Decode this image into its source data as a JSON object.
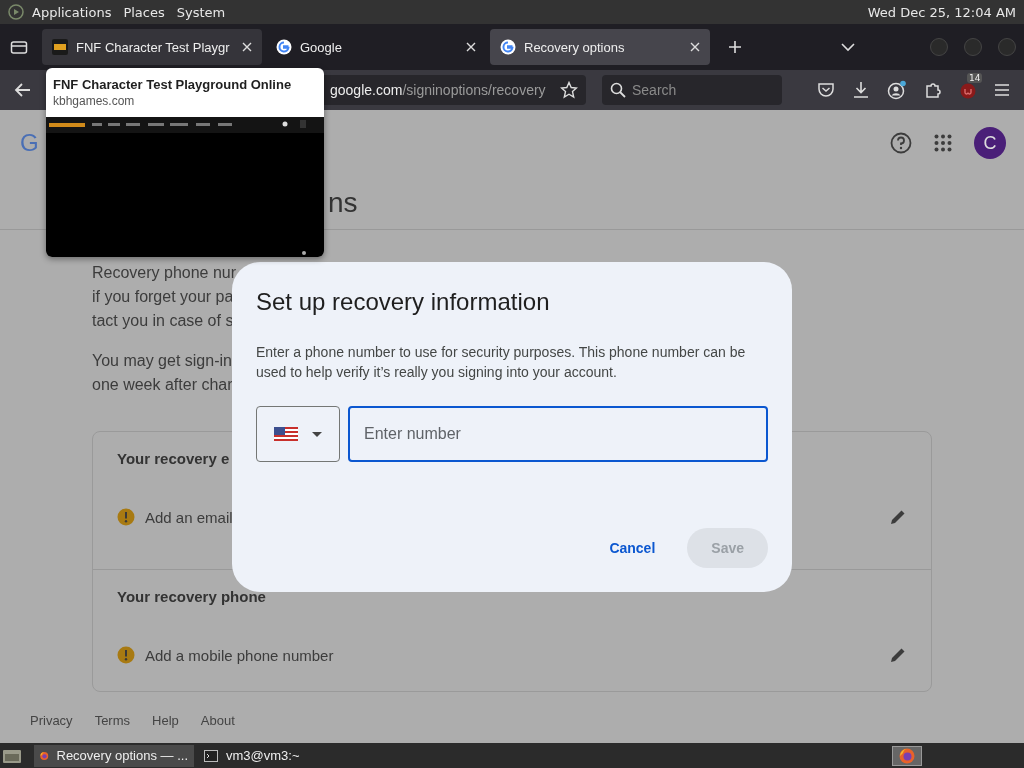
{
  "top_panel": {
    "menus": [
      "Applications",
      "Places",
      "System"
    ],
    "clock": "Wed Dec 25, 12:04 AM"
  },
  "tabs": [
    {
      "title": "FNF Character Test Playgr",
      "kind": "kbh",
      "selected": false,
      "hovered": true
    },
    {
      "title": "Google",
      "kind": "google",
      "selected": false,
      "hovered": false
    },
    {
      "title": "Recovery options",
      "kind": "google",
      "selected": true,
      "hovered": false
    }
  ],
  "nav": {
    "url_host": "google.com",
    "url_path": "/signinoptions/recovery",
    "search_placeholder": "Search",
    "extension_badge": "14"
  },
  "tab_preview": {
    "title": "FNF Character Test Playground Online",
    "domain": "kbhgames.com"
  },
  "page": {
    "logo": "G",
    "avatar": "C",
    "title": "ns",
    "intro_lines": [
      "Recovery phone nur",
      "if you forget your pa",
      "tact you in case of s"
    ],
    "notice_lines": [
      "You may get sign-in",
      "one week after char"
    ],
    "sections": [
      {
        "heading": "Your recovery e",
        "action": "Add an email"
      },
      {
        "heading": "Your recovery phone",
        "action": "Add a mobile phone number"
      }
    ],
    "footer": [
      "Privacy",
      "Terms",
      "Help",
      "About"
    ]
  },
  "dialog": {
    "title": "Set up recovery information",
    "body": "Enter a phone number to use for security purposes. This phone number can be used to help verify it’s really you signing into your account.",
    "placeholder": "Enter number",
    "cancel": "Cancel",
    "save": {
      "label": "Save",
      "disabled": true
    }
  },
  "taskbar": {
    "tasks": [
      {
        "label": "Recovery options — ...",
        "kind": "firefox",
        "selected": true
      },
      {
        "label": "vm3@vm3:~",
        "kind": "terminal",
        "selected": false
      }
    ]
  }
}
